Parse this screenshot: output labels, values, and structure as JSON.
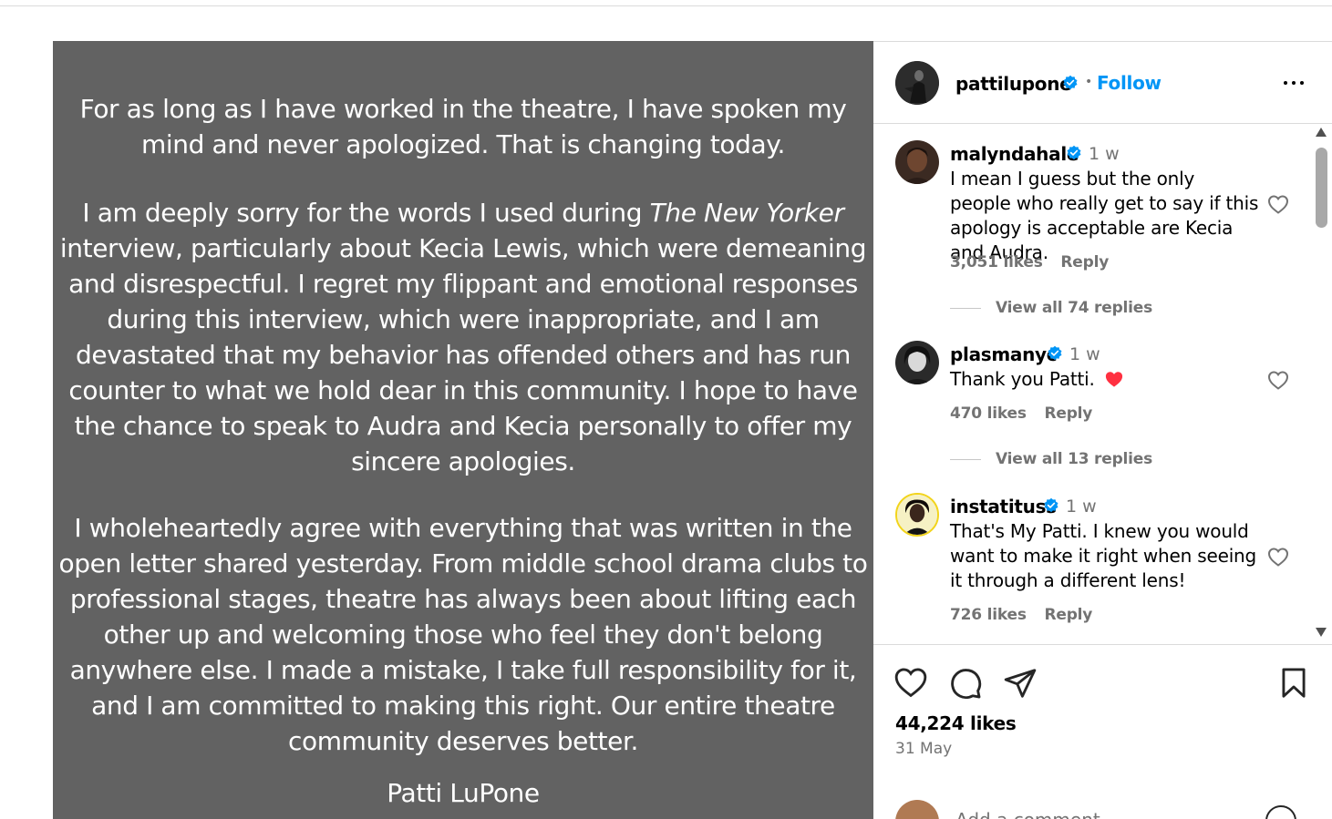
{
  "post": {
    "paragraph1": "For as long as I have worked in the theatre, I have spoken my mind and never apologized. That is changing today.",
    "paragraph2_before": "I am deeply sorry for the words I used during ",
    "paragraph2_italic": "The New Yorker",
    "paragraph2_after": " interview, particularly about Kecia Lewis, which were demeaning and disrespectful. I regret my flippant and emotional responses during this interview, which were inappropriate, and I am devastated that my behavior has offended others and has run counter to what we hold dear in this community. I hope to have the chance to speak to Audra and Kecia personally to offer my sincere apologies.",
    "paragraph3": "I wholeheartedly agree with everything that was written in the open letter shared yesterday. From middle school drama clubs to professional stages, theatre has always been about lifting each other up and welcoming those who feel they don't belong anywhere else. I made a mistake, I take full responsibility for it, and I am committed to making this right. Our entire theatre community deserves better.",
    "signature": "Patti LuPone"
  },
  "header": {
    "username": "pattilupone",
    "separator": "•",
    "follow_label": "Follow"
  },
  "comments": [
    {
      "username": "malyndahale",
      "time": "1 w",
      "text": "I mean I guess but the only people who really get to say if this apology is acceptable are Kecia and Audra.",
      "likes": "3,051 likes",
      "reply": "Reply",
      "view_replies": "View all 74 replies"
    },
    {
      "username": "plasmanyc",
      "time": "1 w",
      "text": "Thank you Patti.",
      "emoji": "heart-emoji",
      "likes": "470 likes",
      "reply": "Reply",
      "view_replies": "View all 13 replies"
    },
    {
      "username": "instatituss",
      "time": "1 w",
      "text": "That's My Patti. I knew you would want to make it right when seeing it through a different lens!",
      "likes": "726 likes",
      "reply": "Reply"
    }
  ],
  "footer": {
    "likes": "44,224 likes",
    "date": "31 May",
    "add_comment_placeholder": "Add a comment..."
  },
  "colors": {
    "post_background": "#626262",
    "follow": "#0095f6",
    "verified": "#0095f6",
    "muted": "#737373",
    "heart_emoji": "#ff3040"
  },
  "icons": [
    "verified-badge-icon",
    "more-options-icon",
    "heart-outline-icon",
    "comment-icon",
    "share-icon",
    "bookmark-icon",
    "emoji-icon"
  ]
}
